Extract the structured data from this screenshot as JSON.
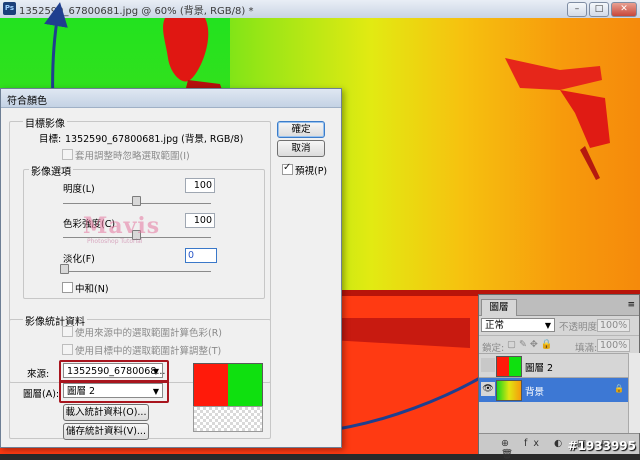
{
  "document": {
    "title": "1352590_67800681.jpg @ 60% (背景, RGB/8) *",
    "app_badge": "Ps"
  },
  "window_controls": {
    "minimize": "–",
    "maximize": "□",
    "close": "✕"
  },
  "dialog": {
    "title": "符合顏色",
    "target_group": {
      "label": "目標影像",
      "target_prefix": "目標:",
      "target_value": "1352590_67800681.jpg (背景, RGB/8)",
      "ignore_selection": "套用調整時忽略選取範圍(I)"
    },
    "image_options": {
      "label": "影像選項",
      "luminance": {
        "label": "明度(L)",
        "value": "100",
        "level": 0.5
      },
      "color_intensity": {
        "label": "色彩強度(C)",
        "value": "100",
        "level": 0.5
      },
      "fade": {
        "label": "淡化(F)",
        "value": "0",
        "level": 0.0
      },
      "neutralize": "中和(N)"
    },
    "statistics": {
      "label": "影像統計資料",
      "use_source_selection": "使用來源中的選取範圍計算色彩(R)",
      "use_target_selection": "使用目標中的選取範圍計算調整(T)",
      "source_label": "來源:",
      "source_value": "1352590_6780068...",
      "layer_label": "圖層(A):",
      "layer_value": "圖層 2",
      "load_button": "載入統計資料(O)...",
      "save_button": "儲存統計資料(V)..."
    },
    "buttons": {
      "ok": "確定",
      "cancel": "取消",
      "preview": "預視(P)"
    },
    "watermark": "Mavis",
    "watermark_sub": "Photoshop Tutorial"
  },
  "layers_panel": {
    "tab": "圖層",
    "blend_mode": "正常",
    "opacity_label": "不透明度:",
    "opacity_value": "100%",
    "lock_label": "鎖定:",
    "fill_label": "填滿:",
    "fill_value": "100%",
    "layers": [
      {
        "name": "圖層 2",
        "selected": false,
        "visible": false
      },
      {
        "name": "背景",
        "selected": true,
        "visible": true
      }
    ],
    "footer_icons": "⊕ fx ◐ ▣ ▤ 🗑"
  },
  "credit": "#1933995"
}
